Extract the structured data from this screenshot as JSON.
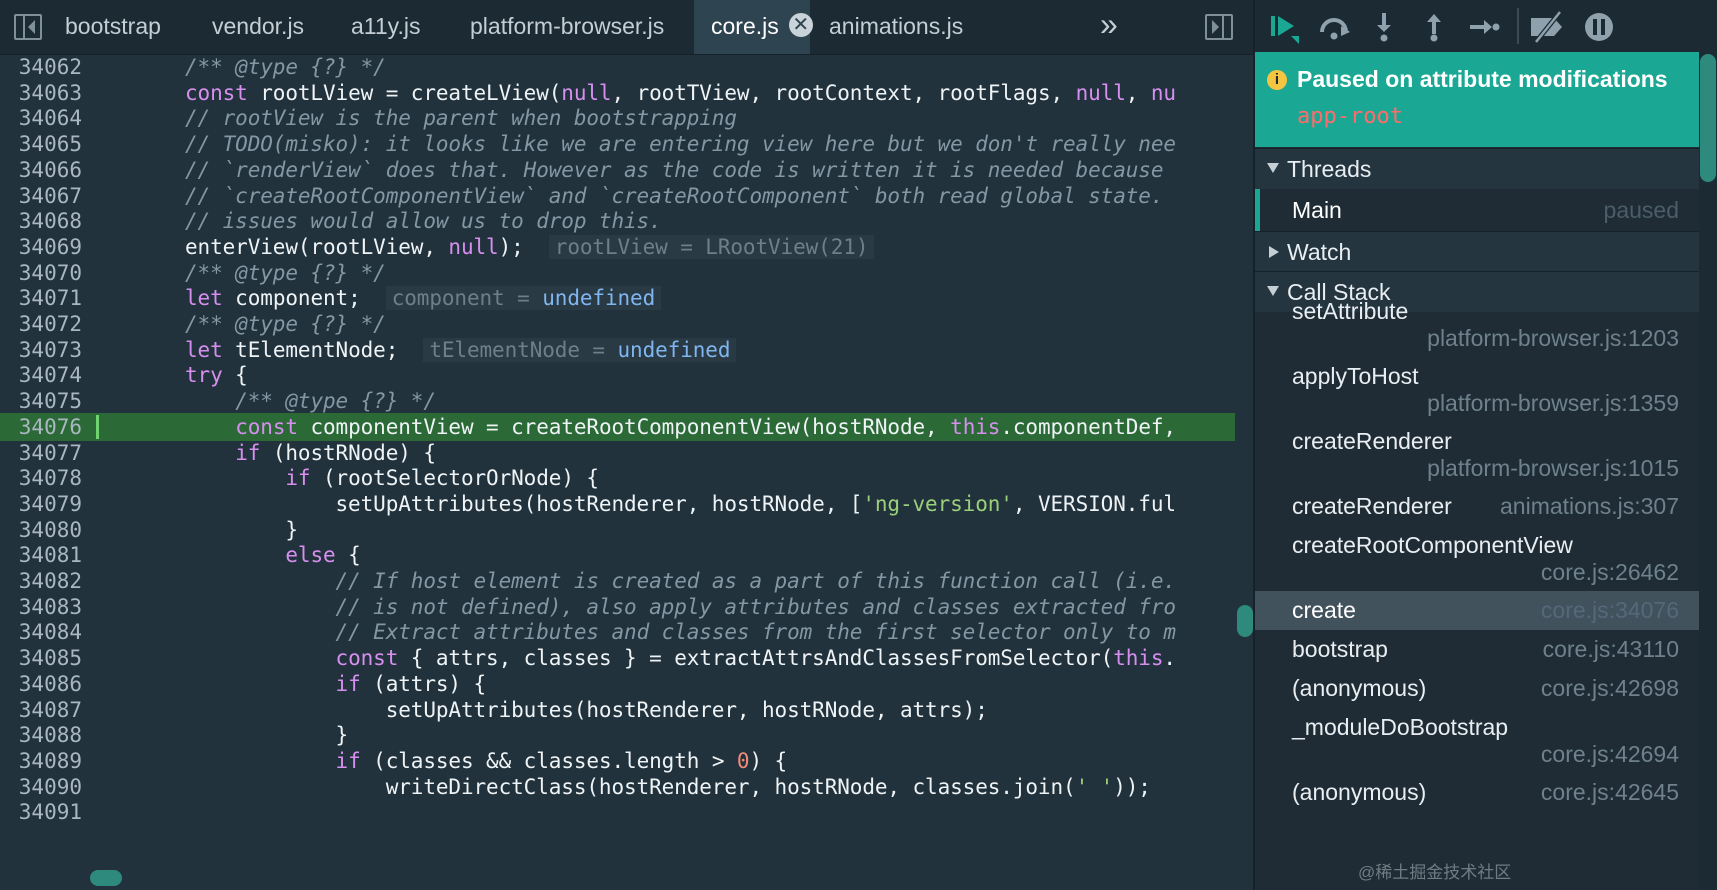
{
  "tabs": {
    "items": [
      "bootstrap",
      "vendor.js",
      "a11y.js",
      "platform-browser.js",
      "core.js",
      "animations.js"
    ],
    "active_index": 4,
    "overflow_glyph": "»",
    "close_glyph": "✕"
  },
  "code_lines": [
    {
      "n": "34062",
      "html": "<span class='c-com'>/** @type {?} */</span>"
    },
    {
      "n": "34063",
      "html": "<span class='c-kw'>const</span> rootLView = createLView(<span class='c-kw'>null</span>, rootTView, rootContext, rootFlags, <span class='c-kw'>null</span>, <span class='c-kw'>nu</span>"
    },
    {
      "n": "34064",
      "html": "<span class='c-com'>// rootView is the parent when bootstrapping</span>"
    },
    {
      "n": "34065",
      "html": "<span class='c-com'>// TODO(misko): it looks like we are entering view here but we don't really nee</span>"
    },
    {
      "n": "34066",
      "html": "<span class='c-com'>// `renderView` does that. However as the code is written it is needed because</span>"
    },
    {
      "n": "34067",
      "html": "<span class='c-com'>// `createRootComponentView` and `createRootComponent` both read global state.</span>"
    },
    {
      "n": "34068",
      "html": "<span class='c-com'>// issues would allow us to drop this.</span>"
    },
    {
      "n": "34069",
      "html": "enterView(rootLView, <span class='c-kw'>null</span>);  <span class='hintbox c-hint'>rootLView = LRootView(21)</span>"
    },
    {
      "n": "34070",
      "html": "<span class='c-com'>/** @type {?} */</span>"
    },
    {
      "n": "34071",
      "html": "<span class='c-kw'>let</span> component;  <span class='hintbox'><span class='c-hint'>component = </span><span class='c-und'>undefined</span></span>"
    },
    {
      "n": "34072",
      "html": "<span class='c-com'>/** @type {?} */</span>"
    },
    {
      "n": "34073",
      "html": "<span class='c-kw'>let</span> tElementNode;  <span class='hintbox'><span class='c-hint'>tElementNode = </span><span class='c-und'>undefined</span></span>"
    },
    {
      "n": "34074",
      "html": "<span class='c-kw'>try</span> {"
    },
    {
      "n": "34075",
      "html": "    <span class='c-com'>/** @type {?} */</span>"
    },
    {
      "n": "34076",
      "html": "    <span class='c-kw'>const</span> componentView = createRootComponentView(hostRNode, <span class='c-kw'>this</span>.componentDef,",
      "exec": true
    },
    {
      "n": "34077",
      "html": "    <span class='c-kw'>if</span> (hostRNode) {"
    },
    {
      "n": "34078",
      "html": "        <span class='c-kw'>if</span> (rootSelectorOrNode) {"
    },
    {
      "n": "34079",
      "html": "            setUpAttributes(hostRenderer, hostRNode, [<span class='c-str'>'ng-version'</span>, VERSION.ful"
    },
    {
      "n": "34080",
      "html": "        }"
    },
    {
      "n": "34081",
      "html": "        <span class='c-kw'>else</span> {"
    },
    {
      "n": "34082",
      "html": "            <span class='c-com'>// If host element is created as a part of this function call (i.e.</span>"
    },
    {
      "n": "34083",
      "html": "            <span class='c-com'>// is not defined), also apply attributes and classes extracted fro</span>"
    },
    {
      "n": "34084",
      "html": "            <span class='c-com'>// Extract attributes and classes from the first selector only to m</span>"
    },
    {
      "n": "34085",
      "html": "            <span class='c-kw'>const</span> { attrs, classes } = extractAttrsAndClassesFromSelector(<span class='c-kw'>this</span>."
    },
    {
      "n": "34086",
      "html": "            <span class='c-kw'>if</span> (attrs) {"
    },
    {
      "n": "34087",
      "html": "                setUpAttributes(hostRenderer, hostRNode, attrs);"
    },
    {
      "n": "34088",
      "html": "            }"
    },
    {
      "n": "34089",
      "html": "            <span class='c-kw'>if</span> (classes &amp;&amp; classes.length &gt; <span class='c-num'>0</span>) {"
    },
    {
      "n": "34090",
      "html": "                writeDirectClass(hostRenderer, hostRNode, classes.join(<span class='c-str'>' '</span>));"
    },
    {
      "n": "34091",
      "html": ""
    }
  ],
  "paused": {
    "title": "Paused on attribute modifications",
    "element": "app-root"
  },
  "threads": {
    "header": "Threads",
    "main_name": "Main",
    "main_state": "paused"
  },
  "watch": {
    "header": "Watch"
  },
  "callstack": {
    "header": "Call Stack",
    "frames": [
      {
        "fn": "setAttribute",
        "loc": "platform-browser.js:1203",
        "two_line": true
      },
      {
        "fn": "applyToHost",
        "loc": "platform-browser.js:1359",
        "two_line": true
      },
      {
        "fn": "createRenderer",
        "loc": "platform-browser.js:1015",
        "two_line": true
      },
      {
        "fn": "createRenderer",
        "loc": "animations.js:307",
        "two_line": false
      },
      {
        "fn": "createRootComponentView",
        "loc": "core.js:26462",
        "two_line": true
      },
      {
        "fn": "create",
        "loc": "core.js:34076",
        "two_line": false,
        "selected": true
      },
      {
        "fn": "bootstrap",
        "loc": "core.js:43110",
        "two_line": false
      },
      {
        "fn": "(anonymous)",
        "loc": "core.js:42698",
        "two_line": false
      },
      {
        "fn": "_moduleDoBootstrap",
        "loc": "core.js:42694",
        "two_line": true
      },
      {
        "fn": "(anonymous)",
        "loc": "core.js:42645",
        "two_line": false
      }
    ]
  },
  "watermark": "@稀土掘金技术社区",
  "colors": {
    "accent": "#1aa894",
    "exec_line": "#2b6a36",
    "keyword": "#d68fef",
    "string": "#9ad07a"
  }
}
